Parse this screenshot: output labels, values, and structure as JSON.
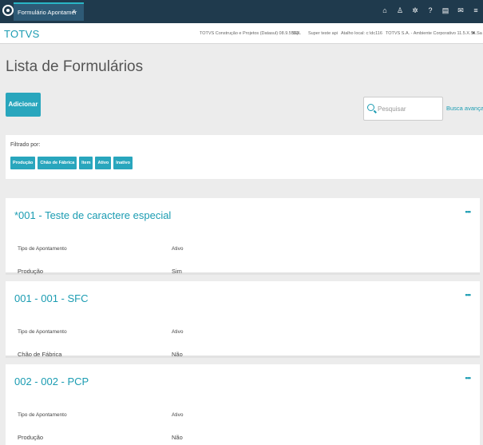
{
  "topbar": {
    "tab_label": "Formulário Apontamer",
    "tab_close": "x",
    "icons": [
      "home-icon",
      "sitemap-icon",
      "gear-icon",
      "help-icon",
      "document-icon",
      "mail-icon",
      "menu-icon"
    ]
  },
  "infobar": {
    "brand": "TOTVS",
    "items": [
      "TOTVS Construção e Projetos (Datasul) 08.9.5554",
      "SQL",
      "Super teste api",
      "Atalho local: c:\\dc116",
      "TOTVS S.A. - Ambiente Corporativo 11.5.X.S...",
      "✖ Sa"
    ]
  },
  "page": {
    "title": "Lista de Formulários",
    "add_button": "Adicionar",
    "search_placeholder": "Pesquisar",
    "advanced_search": "Busca avançada"
  },
  "filter": {
    "label": "Filtrado por:",
    "chips": [
      "Produção",
      "Chão de Fábrica",
      "Item",
      "Ativo",
      "Inativo"
    ]
  },
  "cards": [
    {
      "title": "*001 - Teste de caractere especial",
      "menu": "•••",
      "col1_header": "Tipo de Apontamento",
      "col2_header": "Ativo",
      "col1_value": "Produção",
      "col2_value": "Sim"
    },
    {
      "title": "001 - 001 - SFC",
      "menu": "•••",
      "col1_header": "Tipo de Apontamento",
      "col2_header": "Ativo",
      "col1_value": "Chão de Fábrica",
      "col2_value": "Não"
    },
    {
      "title": "002 - 002 - PCP",
      "menu": "•••",
      "col1_header": "Tipo de Apontamento",
      "col2_header": "Ativo",
      "col1_value": "Produção",
      "col2_value": "Não"
    }
  ],
  "colors": {
    "accent": "#29a6bd",
    "topbar": "#1f3a4d",
    "brand": "#1b9cb2"
  }
}
